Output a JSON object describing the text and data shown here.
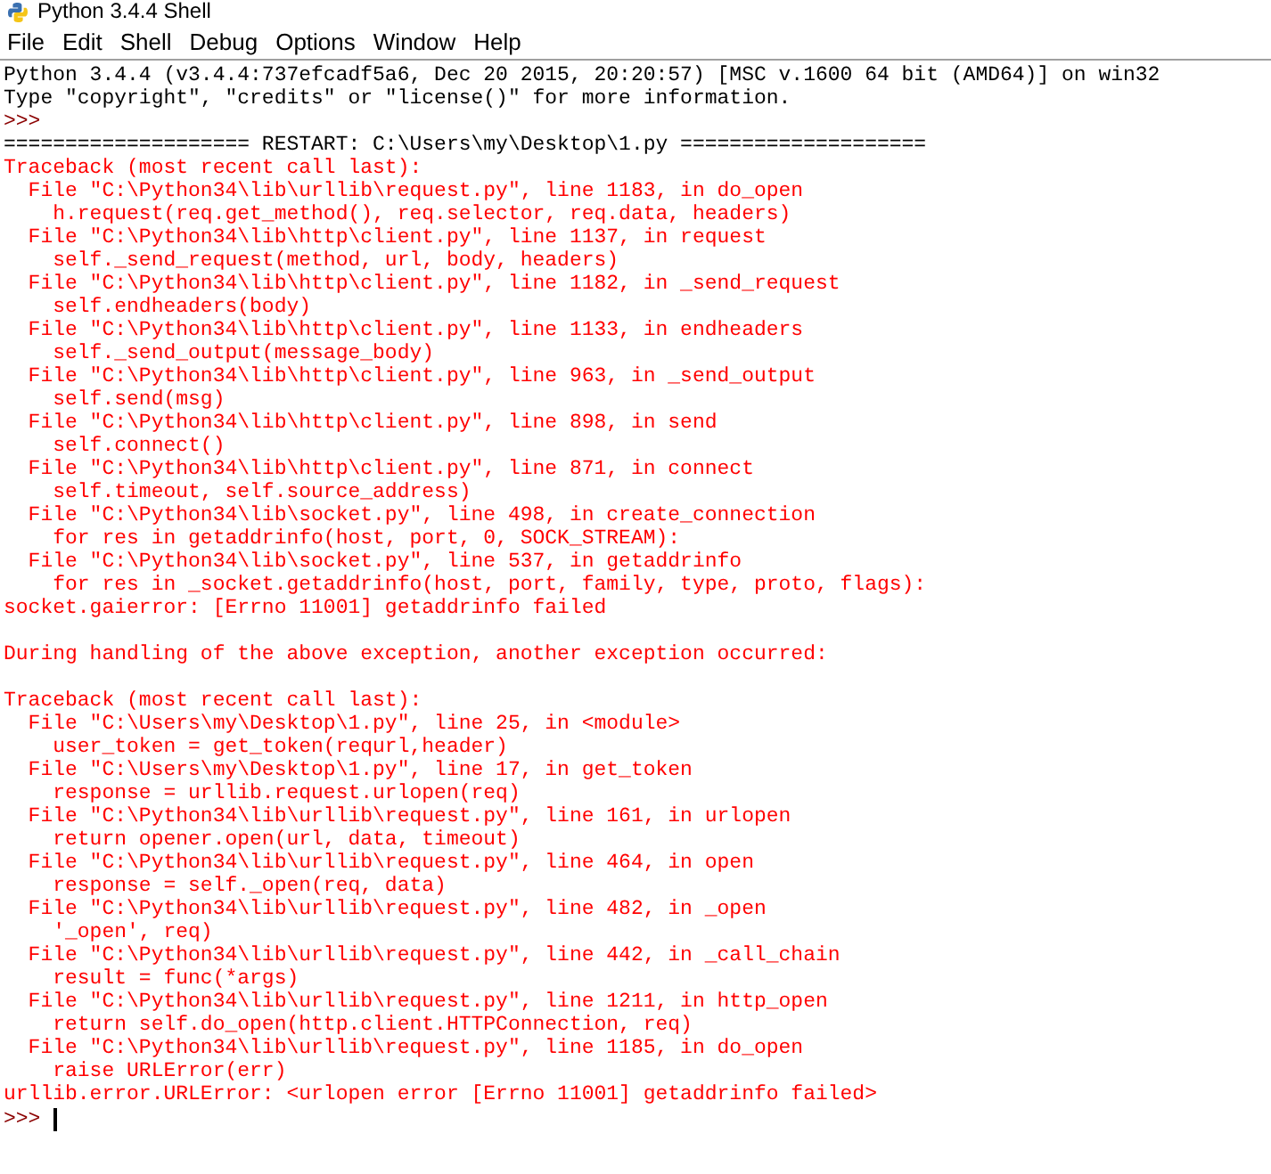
{
  "window": {
    "title": "Python 3.4.4 Shell"
  },
  "menu": [
    "File",
    "Edit",
    "Shell",
    "Debug",
    "Options",
    "Window",
    "Help"
  ],
  "lines": [
    {
      "kind": "output",
      "text": "Python 3.4.4 (v3.4.4:737efcadf5a6, Dec 20 2015, 20:20:57) [MSC v.1600 64 bit (AMD64)] on win32"
    },
    {
      "kind": "output",
      "text": "Type \"copyright\", \"credits\" or \"license()\" for more information."
    },
    {
      "kind": "prompt",
      "text": ">>>"
    },
    {
      "kind": "output",
      "text": "==================== RESTART: C:\\Users\\my\\Desktop\\1.py ===================="
    },
    {
      "kind": "error",
      "text": "Traceback (most recent call last):"
    },
    {
      "kind": "error",
      "text": "  File \"C:\\Python34\\lib\\urllib\\request.py\", line 1183, in do_open"
    },
    {
      "kind": "error",
      "text": "    h.request(req.get_method(), req.selector, req.data, headers)"
    },
    {
      "kind": "error",
      "text": "  File \"C:\\Python34\\lib\\http\\client.py\", line 1137, in request"
    },
    {
      "kind": "error",
      "text": "    self._send_request(method, url, body, headers)"
    },
    {
      "kind": "error",
      "text": "  File \"C:\\Python34\\lib\\http\\client.py\", line 1182, in _send_request"
    },
    {
      "kind": "error",
      "text": "    self.endheaders(body)"
    },
    {
      "kind": "error",
      "text": "  File \"C:\\Python34\\lib\\http\\client.py\", line 1133, in endheaders"
    },
    {
      "kind": "error",
      "text": "    self._send_output(message_body)"
    },
    {
      "kind": "error",
      "text": "  File \"C:\\Python34\\lib\\http\\client.py\", line 963, in _send_output"
    },
    {
      "kind": "error",
      "text": "    self.send(msg)"
    },
    {
      "kind": "error",
      "text": "  File \"C:\\Python34\\lib\\http\\client.py\", line 898, in send"
    },
    {
      "kind": "error",
      "text": "    self.connect()"
    },
    {
      "kind": "error",
      "text": "  File \"C:\\Python34\\lib\\http\\client.py\", line 871, in connect"
    },
    {
      "kind": "error",
      "text": "    self.timeout, self.source_address)"
    },
    {
      "kind": "error",
      "text": "  File \"C:\\Python34\\lib\\socket.py\", line 498, in create_connection"
    },
    {
      "kind": "error",
      "text": "    for res in getaddrinfo(host, port, 0, SOCK_STREAM):"
    },
    {
      "kind": "error",
      "text": "  File \"C:\\Python34\\lib\\socket.py\", line 537, in getaddrinfo"
    },
    {
      "kind": "error",
      "text": "    for res in _socket.getaddrinfo(host, port, family, type, proto, flags):"
    },
    {
      "kind": "error",
      "text": "socket.gaierror: [Errno 11001] getaddrinfo failed"
    },
    {
      "kind": "blank"
    },
    {
      "kind": "error",
      "text": "During handling of the above exception, another exception occurred:"
    },
    {
      "kind": "blank"
    },
    {
      "kind": "error",
      "text": "Traceback (most recent call last):"
    },
    {
      "kind": "error",
      "text": "  File \"C:\\Users\\my\\Desktop\\1.py\", line 25, in <module>"
    },
    {
      "kind": "error",
      "text": "    user_token = get_token(requrl,header)"
    },
    {
      "kind": "error",
      "text": "  File \"C:\\Users\\my\\Desktop\\1.py\", line 17, in get_token"
    },
    {
      "kind": "error",
      "text": "    response = urllib.request.urlopen(req)"
    },
    {
      "kind": "error",
      "text": "  File \"C:\\Python34\\lib\\urllib\\request.py\", line 161, in urlopen"
    },
    {
      "kind": "error",
      "text": "    return opener.open(url, data, timeout)"
    },
    {
      "kind": "error",
      "text": "  File \"C:\\Python34\\lib\\urllib\\request.py\", line 464, in open"
    },
    {
      "kind": "error",
      "text": "    response = self._open(req, data)"
    },
    {
      "kind": "error",
      "text": "  File \"C:\\Python34\\lib\\urllib\\request.py\", line 482, in _open"
    },
    {
      "kind": "error",
      "text": "    '_open', req)"
    },
    {
      "kind": "error",
      "text": "  File \"C:\\Python34\\lib\\urllib\\request.py\", line 442, in _call_chain"
    },
    {
      "kind": "error",
      "text": "    result = func(*args)"
    },
    {
      "kind": "error",
      "text": "  File \"C:\\Python34\\lib\\urllib\\request.py\", line 1211, in http_open"
    },
    {
      "kind": "error",
      "text": "    return self.do_open(http.client.HTTPConnection, req)"
    },
    {
      "kind": "error",
      "text": "  File \"C:\\Python34\\lib\\urllib\\request.py\", line 1185, in do_open"
    },
    {
      "kind": "error",
      "text": "    raise URLError(err)"
    },
    {
      "kind": "error",
      "text": "urllib.error.URLError: <urlopen error [Errno 11001] getaddrinfo failed>"
    }
  ],
  "input_line": {
    "prompt": ">>>",
    "cursor": true
  }
}
